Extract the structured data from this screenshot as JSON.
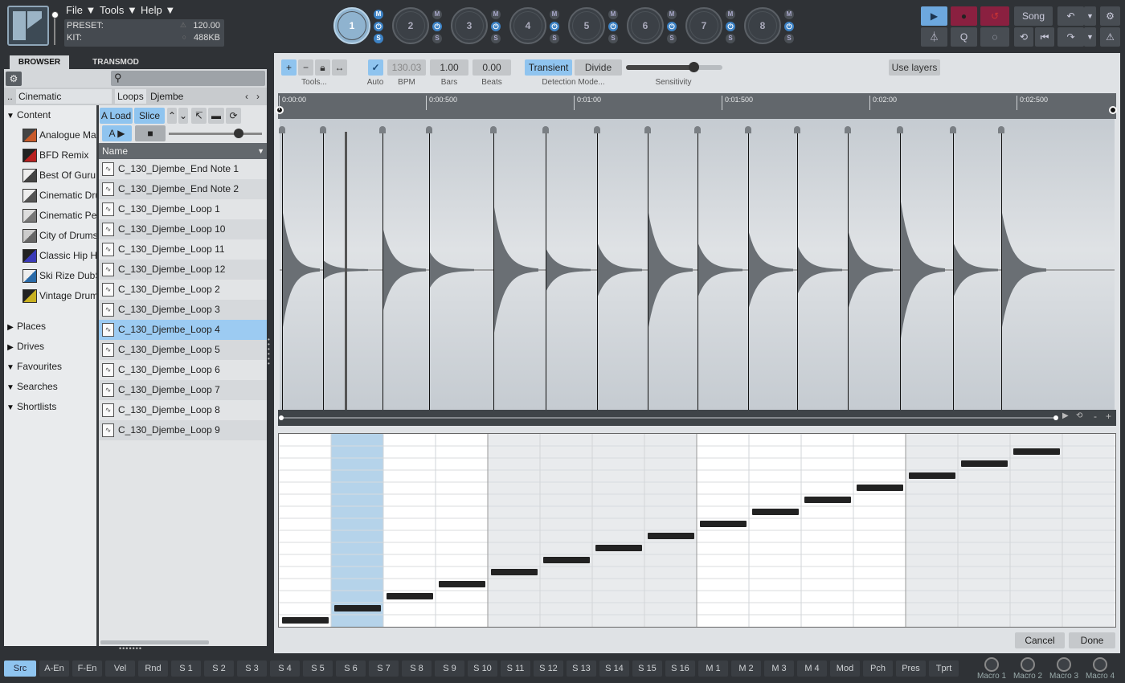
{
  "menu": {
    "file": "File ▼",
    "tools": "Tools ▼",
    "help": "Help ▼"
  },
  "preset": {
    "preset_label": "PRESET:",
    "preset_value": "120.00",
    "kit_label": "KIT:",
    "kit_value": "488KB"
  },
  "pads": [
    {
      "num": "1"
    },
    {
      "num": "2"
    },
    {
      "num": "3"
    },
    {
      "num": "4"
    },
    {
      "num": "5"
    },
    {
      "num": "6"
    },
    {
      "num": "7"
    },
    {
      "num": "8"
    }
  ],
  "ms": {
    "m": "M",
    "s": "S"
  },
  "transport": {
    "song": "Song",
    "q": "Q"
  },
  "browser": {
    "tabs": {
      "browser": "BROWSER",
      "transmod": "TRANSMOD"
    },
    "breadcrumb": {
      "dots": "..",
      "c1": "Cinematic Percussion",
      "c2": "Loops",
      "c3": "Djembe"
    },
    "load": "A Load",
    "slice": "Slice",
    "a": "A",
    "name_header": "Name",
    "tree": [
      {
        "label": "Content",
        "tri": "▼"
      },
      {
        "label": "Analogue Maya",
        "tri": ""
      },
      {
        "label": "BFD Remix",
        "tri": ""
      },
      {
        "label": "Best Of Guru",
        "tri": ""
      },
      {
        "label": "Cinematic Drums",
        "tri": ""
      },
      {
        "label": "Cinematic Percussion",
        "tri": ""
      },
      {
        "label": "City of Drums",
        "tri": ""
      },
      {
        "label": "Classic Hip Hop",
        "tri": ""
      },
      {
        "label": "Ski Rize DubStep",
        "tri": ""
      },
      {
        "label": "Vintage Drum",
        "tri": ""
      },
      {
        "label": "Places",
        "tri": "▶"
      },
      {
        "label": "Drives",
        "tri": "▶"
      },
      {
        "label": "Favourites",
        "tri": "▼"
      },
      {
        "label": "Searches",
        "tri": "▼"
      },
      {
        "label": "Shortlists",
        "tri": "▼"
      }
    ],
    "files": [
      "C_130_Djembe_End Note 1",
      "C_130_Djembe_End Note 2",
      "C_130_Djembe_Loop 1",
      "C_130_Djembe_Loop 10",
      "C_130_Djembe_Loop 11",
      "C_130_Djembe_Loop 12",
      "C_130_Djembe_Loop 2",
      "C_130_Djembe_Loop 3",
      "C_130_Djembe_Loop 4",
      "C_130_Djembe_Loop 5",
      "C_130_Djembe_Loop 6",
      "C_130_Djembe_Loop 7",
      "C_130_Djembe_Loop 8",
      "C_130_Djembe_Loop 9"
    ]
  },
  "editor": {
    "tools_label": "Tools...",
    "auto_label": "Auto",
    "bpm_value": "130.03",
    "bpm_label": "BPM",
    "bars_value": "1.00",
    "bars_label": "Bars",
    "beats_value": "0.00",
    "beats_label": "Beats",
    "transient": "Transient",
    "divide": "Divide",
    "detection_label": "Detection Mode...",
    "sensitivity_label": "Sensitivity",
    "use_layers": "Use layers",
    "ruler": [
      "0:00:00",
      "0:00:500",
      "0:01:00",
      "0:01:500",
      "0:02:00",
      "0:02:500"
    ],
    "overview_controls": {
      "minus": "-",
      "plus": "+"
    },
    "cancel": "Cancel",
    "done": "Done"
  },
  "bottom_tabs": [
    "Src",
    "A-En",
    "F-En",
    "Vel",
    "Rnd",
    "S 1",
    "S 2",
    "S 3",
    "S 4",
    "S 5",
    "S 6",
    "S 7",
    "S 8",
    "S 9",
    "S 10",
    "S 11",
    "S 12",
    "S 13",
    "S 14",
    "S 15",
    "S 16",
    "M 1",
    "M 2",
    "M 3",
    "M 4",
    "Mod",
    "Pch",
    "Pres",
    "Tprt"
  ],
  "macros": [
    "Macro 1",
    "Macro 2",
    "Macro 3",
    "Macro 4"
  ],
  "colors": {
    "accent": "#8fc4ef",
    "selection": "#9ccbf2",
    "record": "#8a2040"
  }
}
